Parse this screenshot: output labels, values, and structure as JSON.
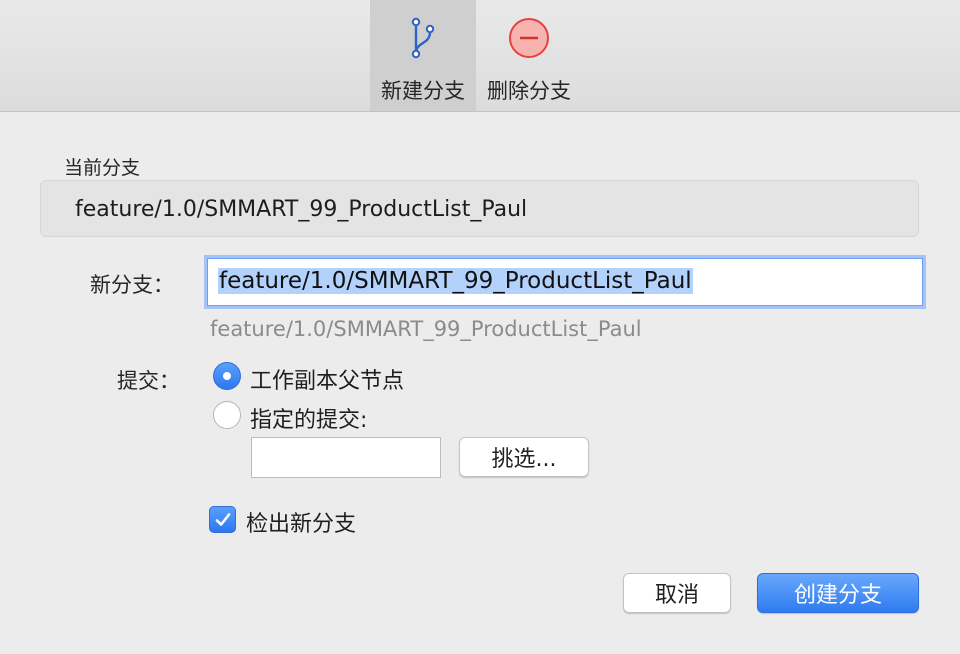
{
  "toolbar": {
    "items": [
      {
        "label": "新建分支",
        "icon": "branch-icon",
        "selected": true
      },
      {
        "label": "删除分支",
        "icon": "minus-circle-icon",
        "selected": false
      }
    ]
  },
  "current_branch": {
    "label": "当前分支",
    "value": "feature/1.0/SMMART_99_ProductList_Paul"
  },
  "new_branch": {
    "label": "新分支：",
    "value": "feature/1.0/SMMART_99_ProductList_Paul",
    "hint": "feature/1.0/SMMART_99_ProductList_Paul"
  },
  "commit": {
    "label": "提交：",
    "options": [
      {
        "label": "工作副本父节点",
        "selected": true
      },
      {
        "label": "指定的提交:",
        "selected": false
      }
    ],
    "commit_value": "",
    "pick_button": "挑选..."
  },
  "checkout": {
    "label": "检出新分支",
    "checked": true
  },
  "buttons": {
    "cancel": "取消",
    "create": "创建分支"
  },
  "colors": {
    "accent": "#2f7bf0",
    "delete_icon": "#e5433f"
  }
}
